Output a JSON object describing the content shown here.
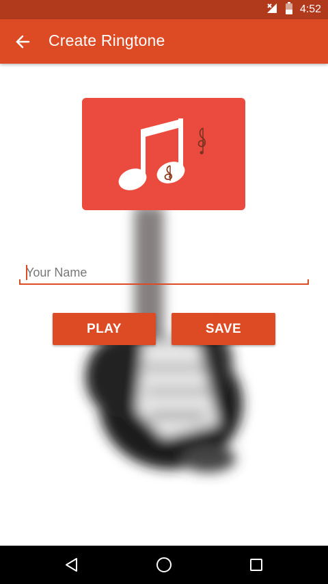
{
  "status_bar": {
    "time": "4:52",
    "icons": [
      "signal-icon",
      "battery-icon"
    ]
  },
  "app_bar": {
    "title": "Create Ringtone",
    "back_icon": "arrow-left-icon"
  },
  "artwork": {
    "card_icon": "music-note-icon",
    "secondary_icon": "treble-clef-icon",
    "background_image": "blurred-electric-guitar"
  },
  "name_input": {
    "placeholder": "Your Name",
    "value": ""
  },
  "buttons": {
    "play_label": "PLAY",
    "save_label": "SAVE"
  },
  "navigation": {
    "back_icon": "nav-back-icon",
    "home_icon": "nav-home-icon",
    "recents_icon": "nav-recents-icon"
  },
  "colors": {
    "status_bar": "#b13a1d",
    "primary": "#dd4b25",
    "card": "#eb4b3e",
    "nav_bar": "#000000"
  }
}
